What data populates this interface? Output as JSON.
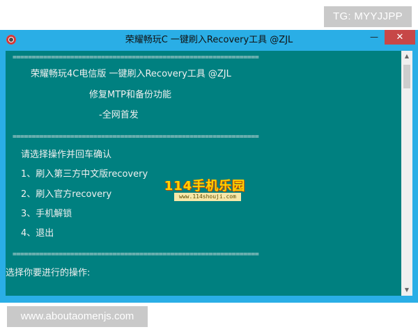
{
  "watermark_top": "TG: MYYJJPP",
  "watermark_bottom": "www.aboutaomenjs.com",
  "window": {
    "title": "荣耀畅玩C 一键刷入Recovery工具 @ZJL",
    "minimize_glyph": "—",
    "close_glyph": "✕"
  },
  "console": {
    "separator": "================================================================",
    "header_line1": "荣耀畅玩4C电信版  一键刷入Recovery工具 @ZJL",
    "header_line2": "修复MTP和备份功能",
    "header_line3": "-全网首发",
    "prompt": "请选择操作并回车确认",
    "options": [
      "1、刷入第三方中文版recovery",
      "2、刷入官方recovery",
      "3、手机解锁",
      "4、退出"
    ],
    "input_prompt": "选择你要进行的操作:"
  },
  "overlay_logo": {
    "main": "114手机乐园",
    "url": "www.114shouji.com"
  },
  "icons": {
    "app": "app-icon",
    "scroll_up": "▲",
    "scroll_down": "▼"
  }
}
